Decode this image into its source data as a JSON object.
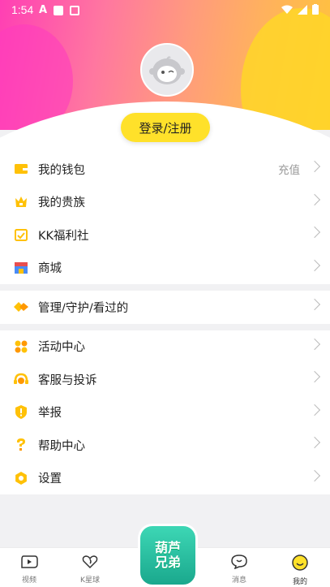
{
  "status": {
    "time": "1:54"
  },
  "header": {
    "login_label": "登录/注册"
  },
  "groups": [
    [
      {
        "label": "我的钱包",
        "extra": "充值",
        "icon": "wallet-icon"
      },
      {
        "label": "我的贵族",
        "extra": "",
        "icon": "crown-icon"
      },
      {
        "label": "KK福利社",
        "extra": "",
        "icon": "calendar-check-icon"
      },
      {
        "label": "商城",
        "extra": "",
        "icon": "store-icon"
      }
    ],
    [
      {
        "label": "管理/守护/看过的",
        "extra": "",
        "icon": "diamond-icon"
      }
    ],
    [
      {
        "label": "活动中心",
        "extra": "",
        "icon": "grid-dots-icon"
      },
      {
        "label": "客服与投诉",
        "extra": "",
        "icon": "headset-icon"
      },
      {
        "label": "举报",
        "extra": "",
        "icon": "alert-shield-icon"
      },
      {
        "label": "帮助中心",
        "extra": "",
        "icon": "question-icon"
      },
      {
        "label": "设置",
        "extra": "",
        "icon": "gear-icon"
      }
    ]
  ],
  "tabbar": {
    "tabs": [
      {
        "label": "视频",
        "icon": "video-icon"
      },
      {
        "label": "K星球",
        "icon": "heart-planet-icon"
      },
      {
        "label": "消息",
        "icon": "message-icon"
      },
      {
        "label": "我的",
        "icon": "profile-icon",
        "active": true
      }
    ],
    "center_badge": "葫芦兄弟"
  },
  "colors": {
    "accent": "#ffe12a",
    "icon_yellow": "#ffc107"
  }
}
